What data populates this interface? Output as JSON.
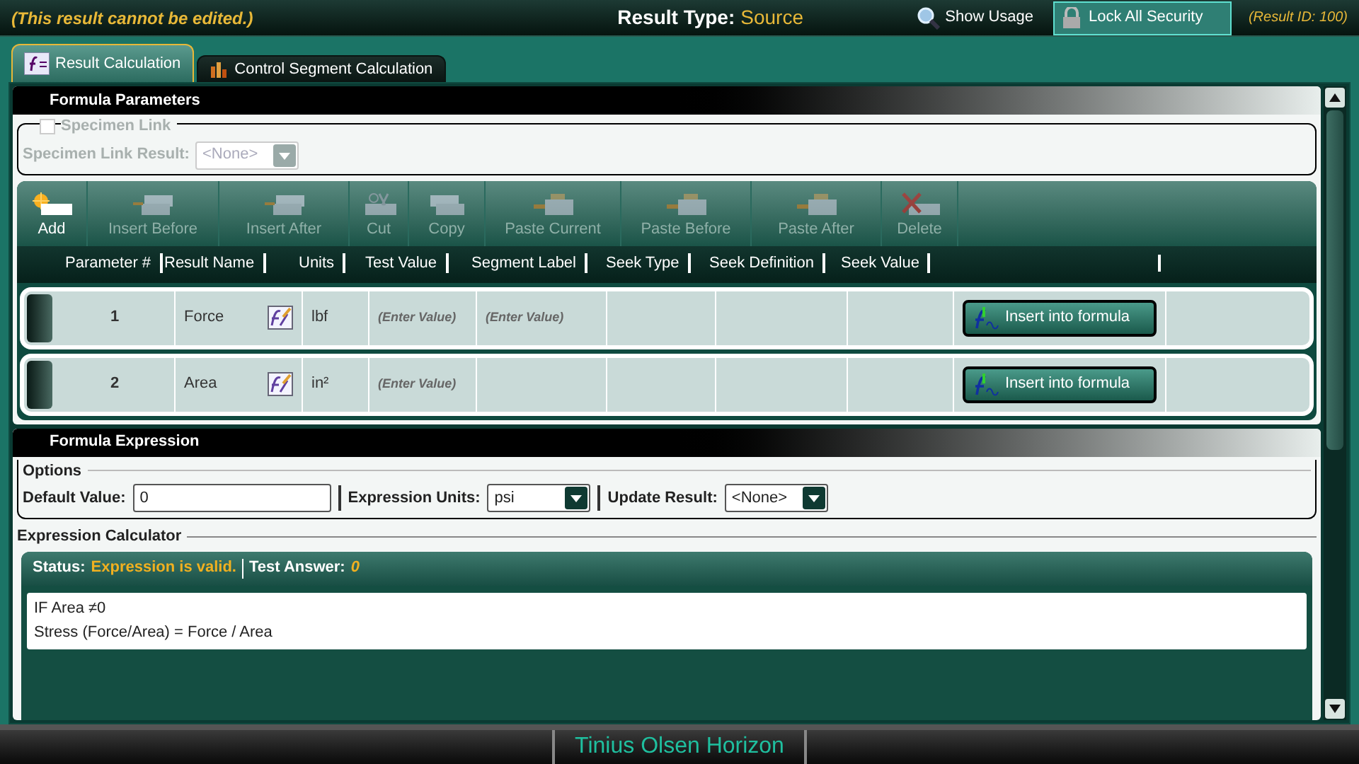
{
  "header": {
    "notice": "(This result cannot be edited.)",
    "result_type_label": "Result Type:",
    "result_type": "Source",
    "show_usage": "Show Usage",
    "lock_all_security": {
      "label": "Lock All Security",
      "selected": true
    },
    "result_id": "(Result ID: 100)"
  },
  "tabs": [
    {
      "label": "Result Calculation",
      "selected": true
    },
    {
      "label": "Control Segment Calculation",
      "selected": false
    }
  ],
  "formula_parameters": {
    "title": "Formula Parameters",
    "specimen_link": {
      "label": "Specimen Link",
      "checked": false,
      "disabled": true
    },
    "specimen_link_result": {
      "label": "Specimen Link Result:",
      "value": "<None>",
      "disabled": true
    },
    "toolbar": [
      {
        "label": "Add",
        "kind": "add",
        "disabled": false
      },
      {
        "label": "Insert Before",
        "kind": "insert",
        "disabled": true
      },
      {
        "label": "Insert After",
        "kind": "insert",
        "disabled": true
      },
      {
        "label": "Cut",
        "kind": "cut",
        "disabled": true
      },
      {
        "label": "Copy",
        "kind": "copy",
        "disabled": true
      },
      {
        "label": "Paste Current",
        "kind": "paste",
        "disabled": true
      },
      {
        "label": "Paste Before",
        "kind": "paste",
        "disabled": true
      },
      {
        "label": "Paste After",
        "kind": "paste",
        "disabled": true
      },
      {
        "label": "Delete",
        "kind": "delete",
        "disabled": true
      }
    ],
    "columns": [
      "Parameter #",
      "Result Name",
      "Units",
      "Test Value",
      "Segment Label",
      "Seek Type",
      "Seek Definition",
      "Seek Value"
    ],
    "rows": [
      {
        "number": "1",
        "result_name": "Force",
        "units": "lbf",
        "test_value": "(Enter Value)",
        "segment_label": "(Enter Value)",
        "button": "Insert into formula"
      },
      {
        "number": "2",
        "result_name": "Area",
        "units": "in²",
        "test_value": "(Enter Value)",
        "button": "Insert into formula"
      }
    ]
  },
  "formula_expression": {
    "title": "Formula Expression",
    "options": {
      "title": "Options",
      "default_value": {
        "label": "Default Value:",
        "value": "0"
      },
      "expression_units": {
        "label": "Expression Units:",
        "value": "psi"
      },
      "update_result": {
        "label": "Update Result:",
        "value": "<None>"
      }
    },
    "calculator": {
      "title": "Expression Calculator",
      "status_label": "Status:",
      "status": "Expression is valid.",
      "test_answer_label": "Test Answer:",
      "test_answer": "0",
      "lines": [
        "IF Area ≠0",
        "Stress (Force/Area) = Force / Area"
      ]
    }
  },
  "footer": "Tinius Olsen Horizon"
}
